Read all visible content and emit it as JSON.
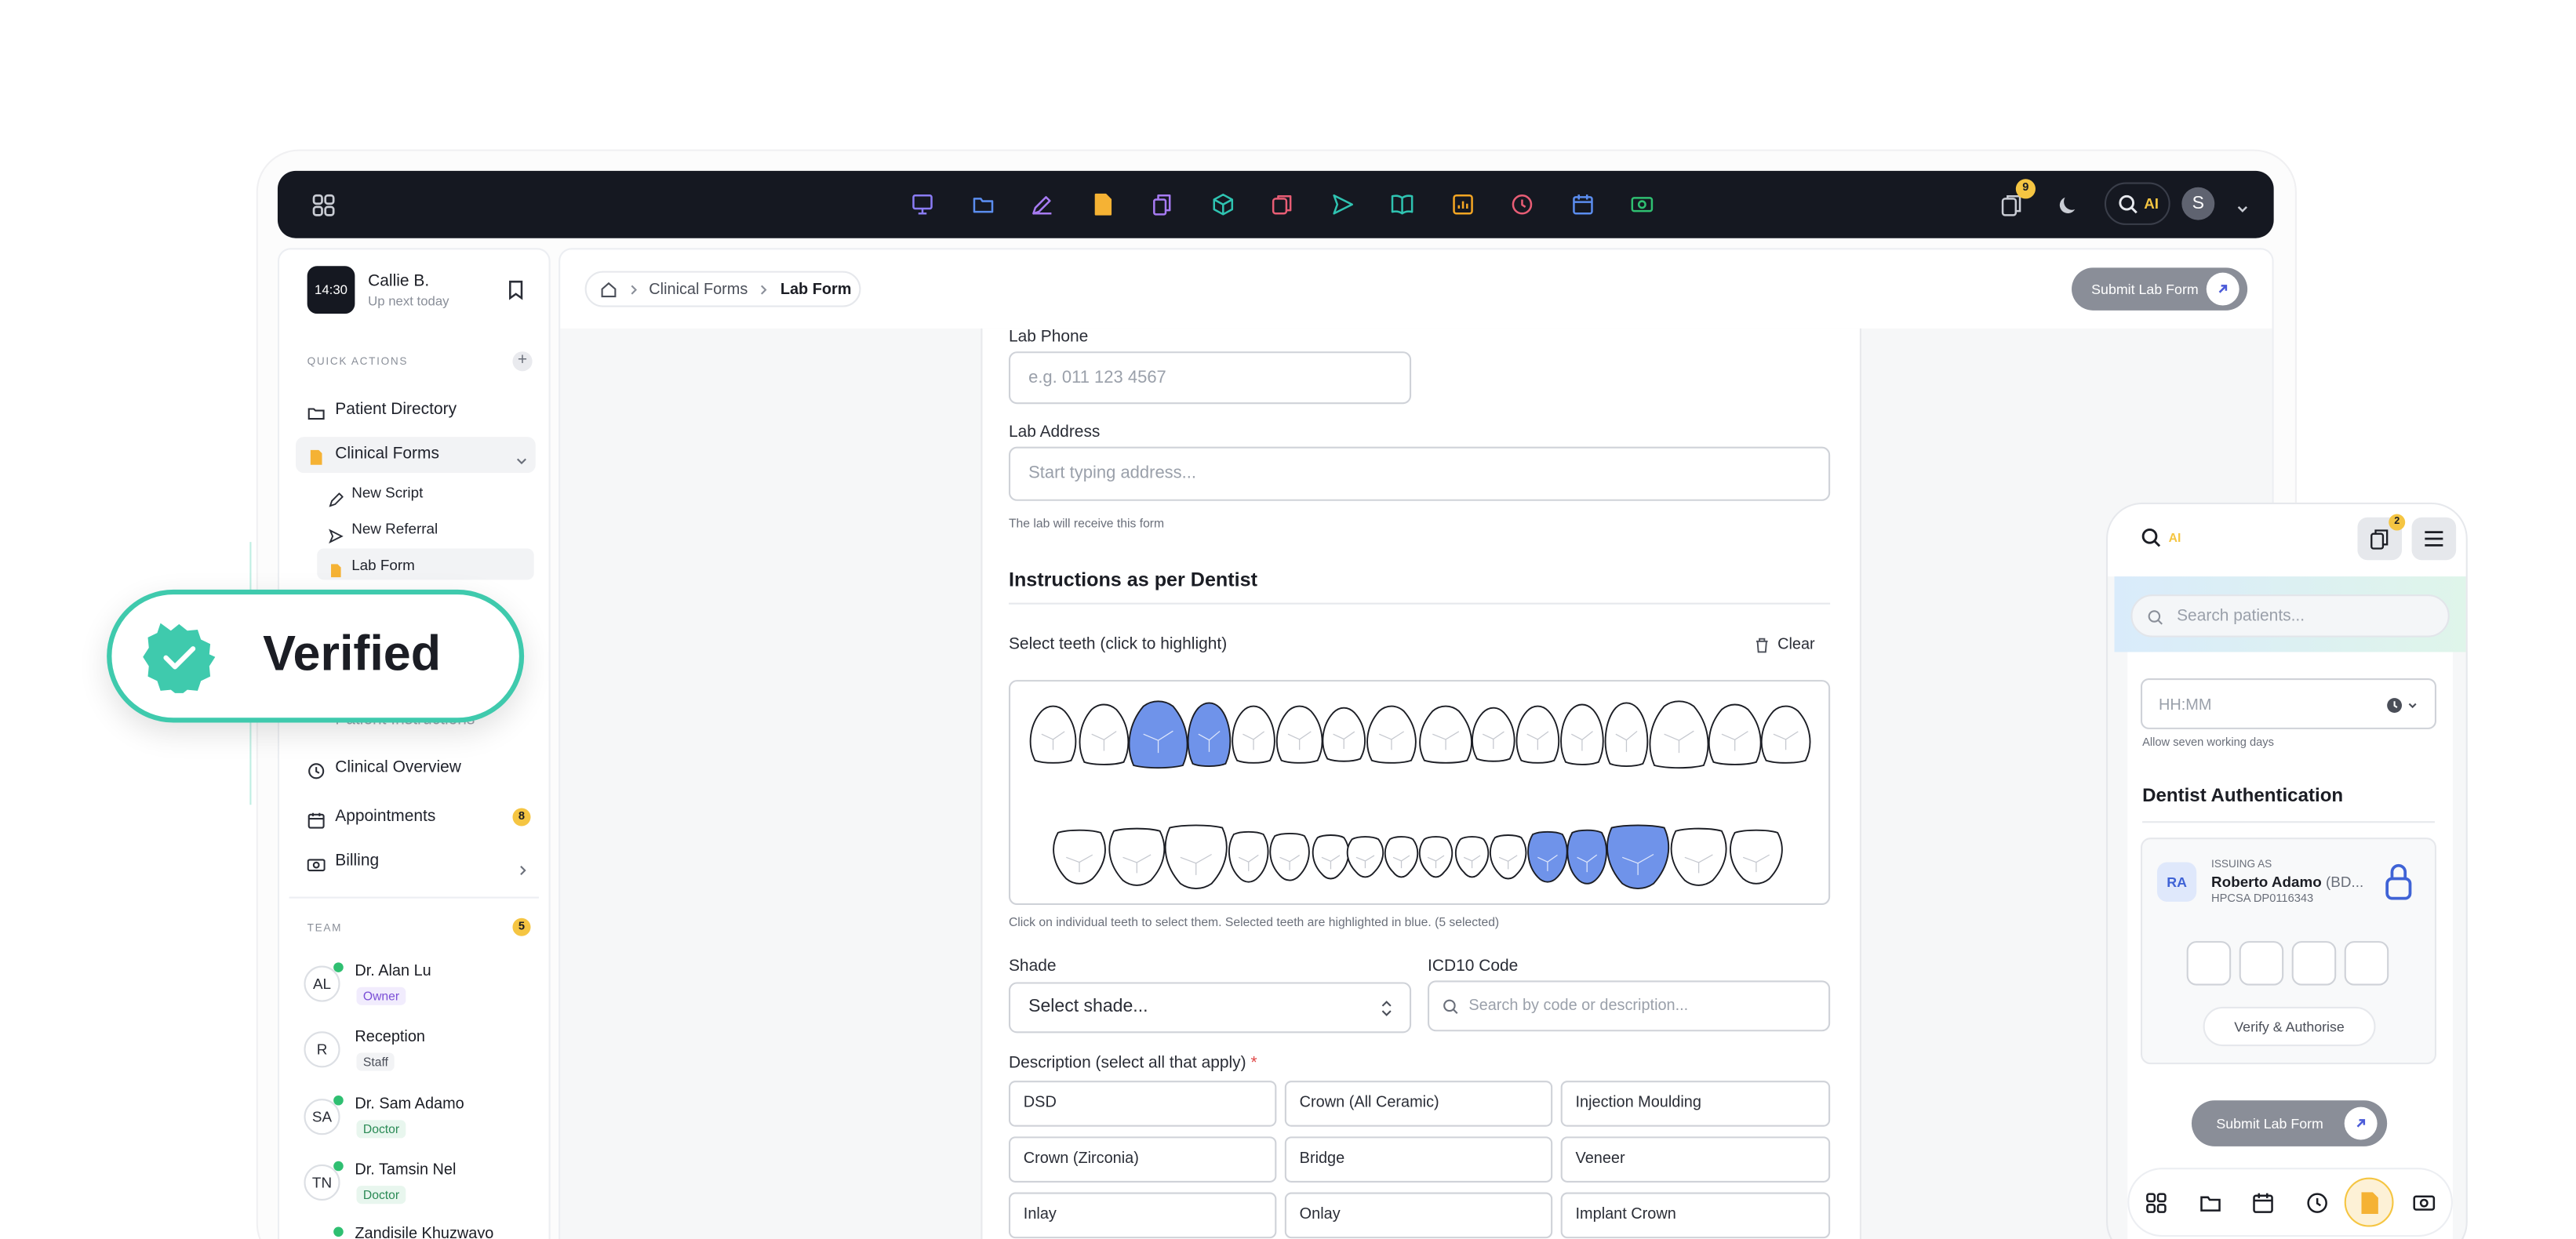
{
  "topbar": {
    "notif_count": "9",
    "ai_label": "AI",
    "user_initial": "S",
    "app_icons": [
      "presentation-icon",
      "folder-icon",
      "edit-icon",
      "document-icon",
      "files-icon",
      "cube-icon",
      "copy-icon",
      "send-icon",
      "book-icon",
      "chart-icon",
      "clock-icon",
      "calendar-icon",
      "money-icon"
    ],
    "app_colors": [
      "#8b7cf6",
      "#5b8def",
      "#a77bf3",
      "#f5b234",
      "#a77bf3",
      "#2fc3b1",
      "#e85d75",
      "#2fc3b1",
      "#2fc3b1",
      "#f5a623",
      "#e85d75",
      "#5b8def",
      "#2fbf71"
    ]
  },
  "sidebar": {
    "time": "14:30",
    "user_name": "Callie B.",
    "user_sub": "Up next today",
    "quick_actions_label": "QUICK ACTIONS",
    "items": [
      {
        "label": "Patient Directory"
      },
      {
        "label": "Clinical Forms"
      },
      {
        "label": "Clinical Overview"
      },
      {
        "label": "Appointments",
        "badge": "8"
      },
      {
        "label": "Billing"
      }
    ],
    "sub_items": [
      {
        "label": "New Script"
      },
      {
        "label": "New Referral"
      },
      {
        "label": "Lab Form"
      }
    ],
    "hidden_item": "Patient Instructions",
    "team_label": "TEAM",
    "team_count": "5",
    "team": [
      {
        "initials": "AL",
        "name": "Dr. Alan Lu",
        "role": "Owner"
      },
      {
        "initials": "R",
        "name": "Reception",
        "role": "Staff"
      },
      {
        "initials": "SA",
        "name": "Dr. Sam Adamo",
        "role": "Doctor"
      },
      {
        "initials": "TN",
        "name": "Dr. Tamsin Nel",
        "role": "Doctor"
      },
      {
        "initials": "",
        "name": "Zandisile Khuzwayo",
        "role": ""
      }
    ]
  },
  "verified_badge": {
    "label": "Verified"
  },
  "breadcrumb": {
    "parent": "Clinical Forms",
    "current": "Lab Form"
  },
  "header": {
    "submit_label": "Submit Lab Form"
  },
  "form": {
    "lab_phone_label": "Lab Phone",
    "lab_phone_placeholder": "e.g. 011 123 4567",
    "lab_address_label": "Lab Address",
    "lab_address_placeholder": "Start typing address...",
    "lab_address_help": "The lab will receive this form",
    "section_title": "Instructions as per Dentist",
    "teeth_label": "Select teeth (click to highlight)",
    "clear_label": "Clear",
    "teeth_help": "Click on individual teeth to select them. Selected teeth are highlighted in blue. (5 selected)",
    "shade_label": "Shade",
    "shade_value": "Select shade...",
    "icd_label": "ICD10 Code",
    "icd_placeholder": "Search by code or description...",
    "description_label": "Description (select all that apply)",
    "required_mark": "*",
    "options": [
      "DSD",
      "Crown (All Ceramic)",
      "Injection Moulding",
      "Crown (Zirconia)",
      "Bridge",
      "Veneer",
      "Inlay",
      "Onlay",
      "Implant Crown"
    ]
  },
  "phone": {
    "ai_label": "AI",
    "notif_count": "2",
    "search_placeholder": "Search patients...",
    "time_placeholder": "HH:MM",
    "time_help": "Allow seven working days",
    "section_title": "Dentist Authentication",
    "issuing_label": "ISSUING AS",
    "issuer_initials": "RA",
    "issuer_name": "Roberto Adamo",
    "issuer_suffix": "(BD...",
    "issuer_hpcsa": "HPCSA DP0116343",
    "verify_label": "Verify & Authorise",
    "submit_label": "Submit Lab Form",
    "nav_icons": [
      "grid-icon",
      "folder-icon",
      "calendar-icon",
      "clock-icon",
      "document-icon",
      "money-icon"
    ]
  },
  "colors": {
    "accent_teal": "#3fcaad",
    "selected_tooth": "#6f93ea",
    "dark_bar": "#151821",
    "badge_yellow": "#f5c542"
  }
}
